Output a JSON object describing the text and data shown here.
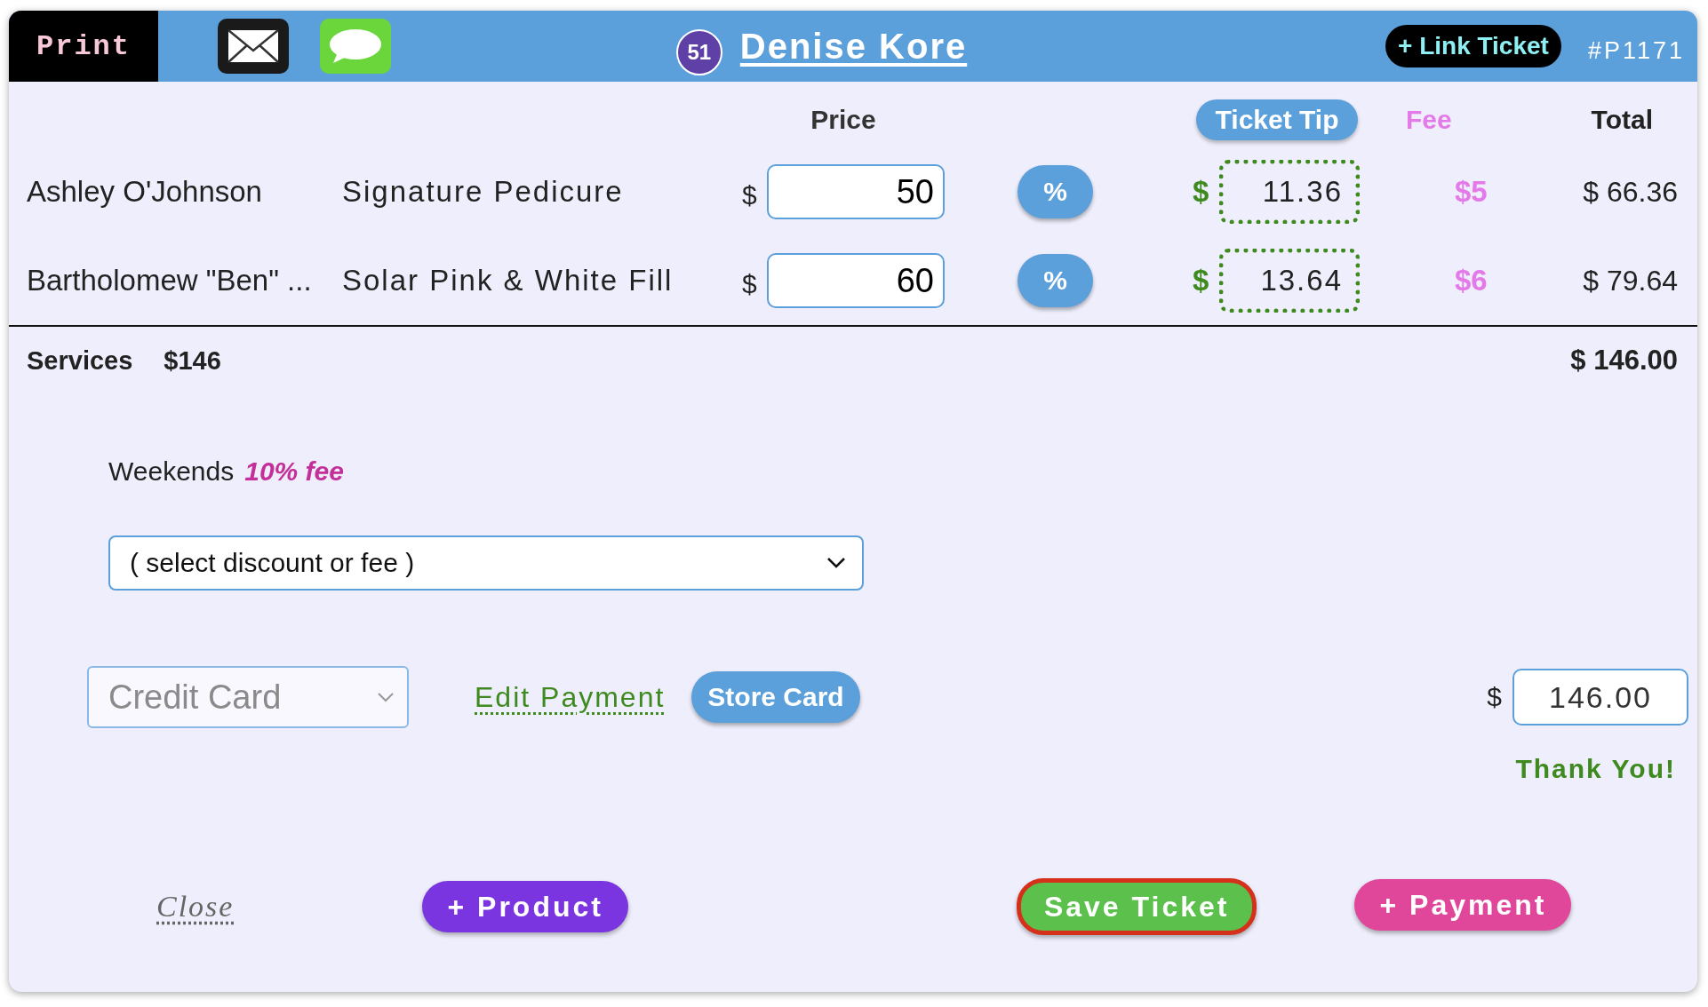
{
  "header": {
    "print_button": "Print",
    "customer_badge": "51",
    "customer_name": "Denise Kore",
    "link_ticket_button": "+ Link Ticket",
    "ticket_number": "#P1171"
  },
  "columns": {
    "price": "Price",
    "tip": "Ticket Tip",
    "fee": "Fee",
    "total": "Total"
  },
  "lines": [
    {
      "client": "Ashley O'Johnson",
      "service": "Signature Pedicure",
      "currency": "$",
      "price": "50",
      "percent_button": "%",
      "tip_currency": "$",
      "tip": "11.36",
      "fee": "$5",
      "total": "$ 66.36"
    },
    {
      "client": "Bartholomew \"Ben\" ...",
      "service": "Solar Pink & White Fill",
      "currency": "$",
      "price": "60",
      "percent_button": "%",
      "tip_currency": "$",
      "tip": "13.64",
      "fee": "$6",
      "total": "$ 79.64"
    }
  ],
  "summary": {
    "label": "Services",
    "amount": "$146",
    "total": "$ 146.00"
  },
  "promo": {
    "label": "Weekends",
    "highlight": "10% fee"
  },
  "discount_select": {
    "value": "( select discount or fee )"
  },
  "payment": {
    "method": "Credit Card",
    "disabled": true,
    "edit_link": "Edit Payment",
    "store_card_button": "Store Card",
    "currency": "$",
    "amount": "146.00",
    "thank_you": "Thank You!"
  },
  "footer": {
    "close_link": "Close",
    "product_button": "+ Product",
    "save_button": "Save Ticket",
    "payment_button": "+ Payment"
  }
}
